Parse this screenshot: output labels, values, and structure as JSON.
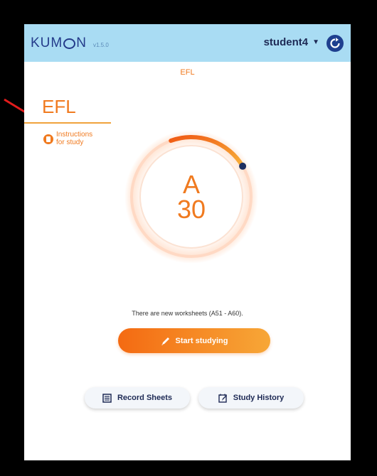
{
  "header": {
    "logo_part1": "KUM",
    "logo_part2": "N",
    "version": "v1.5.0",
    "username": "student4",
    "caret": "▼"
  },
  "subject_header": "EFL",
  "sidebar": {
    "title": "EFL",
    "instructions_label": "Instructions for study"
  },
  "progress": {
    "level": "A",
    "number": "30",
    "fraction": 0.22
  },
  "notice": "There are new worksheets (A51 - A60).",
  "buttons": {
    "start": "Start studying",
    "record": "Record Sheets",
    "history": "Study History"
  },
  "colors": {
    "accent": "#f07a1f",
    "header_bg": "#a9dcf3",
    "navy": "#1e2a55"
  }
}
